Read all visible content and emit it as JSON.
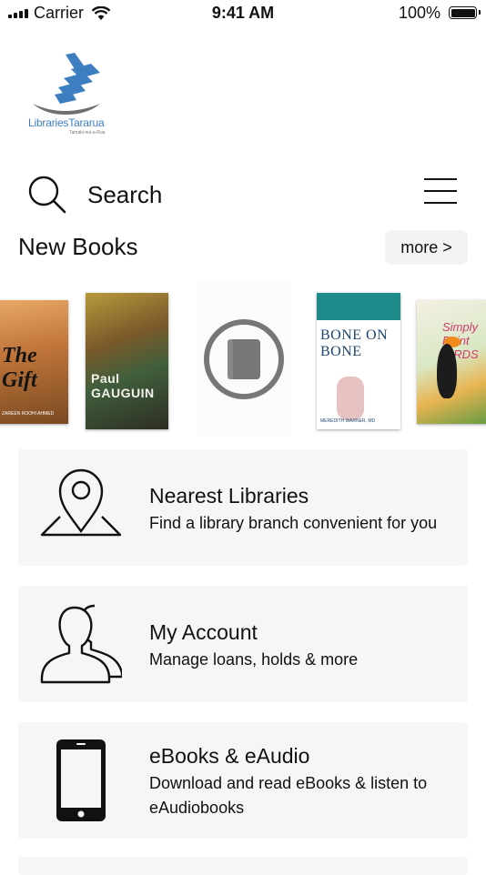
{
  "status_bar": {
    "carrier": "Carrier",
    "time": "9:41 AM",
    "battery": "100%"
  },
  "logo": {
    "text": "LibrariesTararua",
    "subtitle": "Tamaki-nui-a-Rua",
    "color": "#3d7ec1"
  },
  "search": {
    "placeholder": "Search"
  },
  "new_books": {
    "title": "New Books",
    "more_label": "more >",
    "books": [
      {
        "title": "The Gift",
        "author": "ZAREEN ROOHI AHMED"
      },
      {
        "title": "Paul GAUGUIN"
      },
      {
        "title": "",
        "placeholder_icon": "book-icon"
      },
      {
        "title": "BONE ON BONE",
        "author": "MEREDITH WARNER, MD"
      },
      {
        "title": "Simply Paint BIRDS"
      }
    ]
  },
  "cards": [
    {
      "title": "Nearest Libraries",
      "description": "Find a library branch convenient for you",
      "icon": "map-pin-icon"
    },
    {
      "title": "My Account",
      "description": "Manage loans, holds & more",
      "icon": "users-icon"
    },
    {
      "title": "eBooks & eAudio",
      "description": "Download and read eBooks & listen to eAudiobooks",
      "icon": "phone-icon"
    }
  ],
  "colors": {
    "card_bg": "#f6f6f6",
    "more_bg": "#f3f3f3",
    "brand": "#3d7ec1"
  }
}
